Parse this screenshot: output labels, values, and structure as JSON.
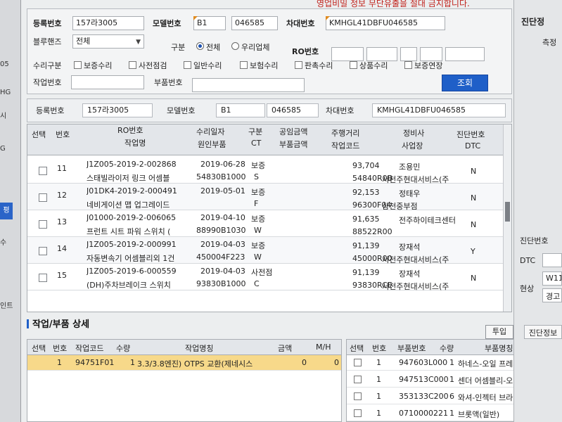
{
  "warning_text": "영업비밀 정보 무단유출을 절대 금지합니다.",
  "left_strip": {
    "texts": [
      "05",
      "HG",
      "시",
      "G",
      "수",
      "인트"
    ],
    "tab_label": "평"
  },
  "search": {
    "reg_no_label": "등록번호",
    "reg_no_value": "157라3005",
    "model_no_label": "모델번호",
    "model_no_value1": "B1",
    "model_no_value2": "046585",
    "vin_label": "차대번호",
    "vin_value": "KMHGL41DBFU046585",
    "bluehands_label": "블루핸즈",
    "bluehands_value": "전체",
    "type_label": "구분",
    "type_options": [
      "전체",
      "우리업체"
    ],
    "type_selected": "전체",
    "ro_label": "RO번호",
    "repair_label": "수리구분",
    "repair_options": [
      "보증수리",
      "사전점검",
      "일반수리",
      "보험수리",
      "판촉수리",
      "상품수리",
      "보증연장"
    ],
    "work_no_label": "작업번호",
    "part_no_label": "부품번호",
    "search_button": "조회"
  },
  "vehicle": {
    "reg_no_label": "등록번호",
    "reg_no_value": "157라3005",
    "model_label": "모델번호",
    "model_value1": "B1",
    "model_value2": "046585",
    "vin_label": "차대번호",
    "vin_value": "KMHGL41DBFU046585"
  },
  "ro_table": {
    "headers_top": [
      "선택",
      "번호",
      "RO번호",
      "수리일자",
      "구분",
      "공임금액",
      "주행거리",
      "정비사",
      "진단번호"
    ],
    "headers_bottom": [
      "작업명",
      "원인부품",
      "CT",
      "부품금액",
      "작업코드",
      "사업장",
      "DTC"
    ],
    "rows": [
      {
        "no": "11",
        "ro": "J1Z005-2019-2-002868",
        "work": "스태빌라이저 링크 어셈블",
        "date": "2019-06-28",
        "part": "54830B1000",
        "type": "보증",
        "ct": "S",
        "mileage": "93,704",
        "code": "54840R0B",
        "mechanic": "조용민",
        "shop": "서전주현대서비스(주",
        "diag": "N"
      },
      {
        "no": "12",
        "ro": "J01DK4-2019-2-000491",
        "work": "네비게이션 맵 업그레이드",
        "date": "2019-05-01",
        "part": "",
        "type": "보증",
        "ct": "F",
        "mileage": "92,153",
        "code": "96300F04",
        "mechanic": "정태우",
        "shop": "삼천중부점",
        "diag": "N"
      },
      {
        "no": "13",
        "ro": "J01000-2019-2-006065",
        "work": "프런트 시트 파워 스위치 (",
        "date": "2019-04-10",
        "part": "88990B1030",
        "type": "보증",
        "ct": "W",
        "mileage": "91,635",
        "code": "88522R00",
        "mechanic": "전주하이테크센터",
        "shop": "",
        "diag": "N"
      },
      {
        "no": "14",
        "ro": "J1Z005-2019-2-000991",
        "work": "자동변속기 어셈블리외 1건",
        "date": "2019-04-03",
        "part": "450004F223",
        "type": "보증",
        "ct": "W",
        "mileage": "91,139",
        "code": "45000R00",
        "mechanic": "장재석",
        "shop": "서전주현대서비스(주",
        "diag": "Y"
      },
      {
        "no": "15",
        "ro": "J1Z005-2019-6-000559",
        "work": "(DH)주차브레이크 스위치",
        "date": "2019-04-03",
        "part": "93830B1000",
        "type": "사전점",
        "ct": "C",
        "mileage": "91,139",
        "code": "93830RCE",
        "mechanic": "장재석",
        "shop": "서전주현대서비스(주",
        "diag": "N"
      }
    ]
  },
  "detail": {
    "title": "작업/부품 상세",
    "input_button": "투입",
    "work_headers": [
      "선택",
      "번호",
      "작업코드",
      "수량",
      "작업명칭",
      "금액",
      "M/H"
    ],
    "work_rows": [
      {
        "no": "1",
        "code": "94751F01",
        "qty": "1",
        "name": "3.3/3.8엔진) OTPS 교환(제네시스",
        "amount": "0",
        "mh": "0"
      }
    ],
    "parts_headers": [
      "선택",
      "번호",
      "부품번호",
      "수량",
      "부품명칭"
    ],
    "parts_rows": [
      {
        "no": "1",
        "part": "947603L000",
        "qty": "1",
        "name": "하네스-오일 프레셔 센서"
      },
      {
        "no": "1",
        "part": "947513C000",
        "qty": "1",
        "name": "센더 어셈블리-오일 프레셔"
      },
      {
        "no": "1",
        "part": "353133C200",
        "qty": "6",
        "name": "와셔-인젝터 브라켓"
      },
      {
        "no": "1",
        "part": "0710000221",
        "qty": "1",
        "name": "브롯액(일반)"
      }
    ]
  },
  "right_panel": {
    "title": "진단정",
    "measure_label": "측정",
    "diag_no_label": "진단번호",
    "dtc_label": "DTC",
    "status_label": "현상",
    "status_value1": "W11",
    "status_value2": "경고",
    "diag_info_button": "진단정보"
  },
  "colors": {
    "accent": "#1f5fc8",
    "selected_row": "#f7d98a",
    "warning": "#c0211b"
  }
}
